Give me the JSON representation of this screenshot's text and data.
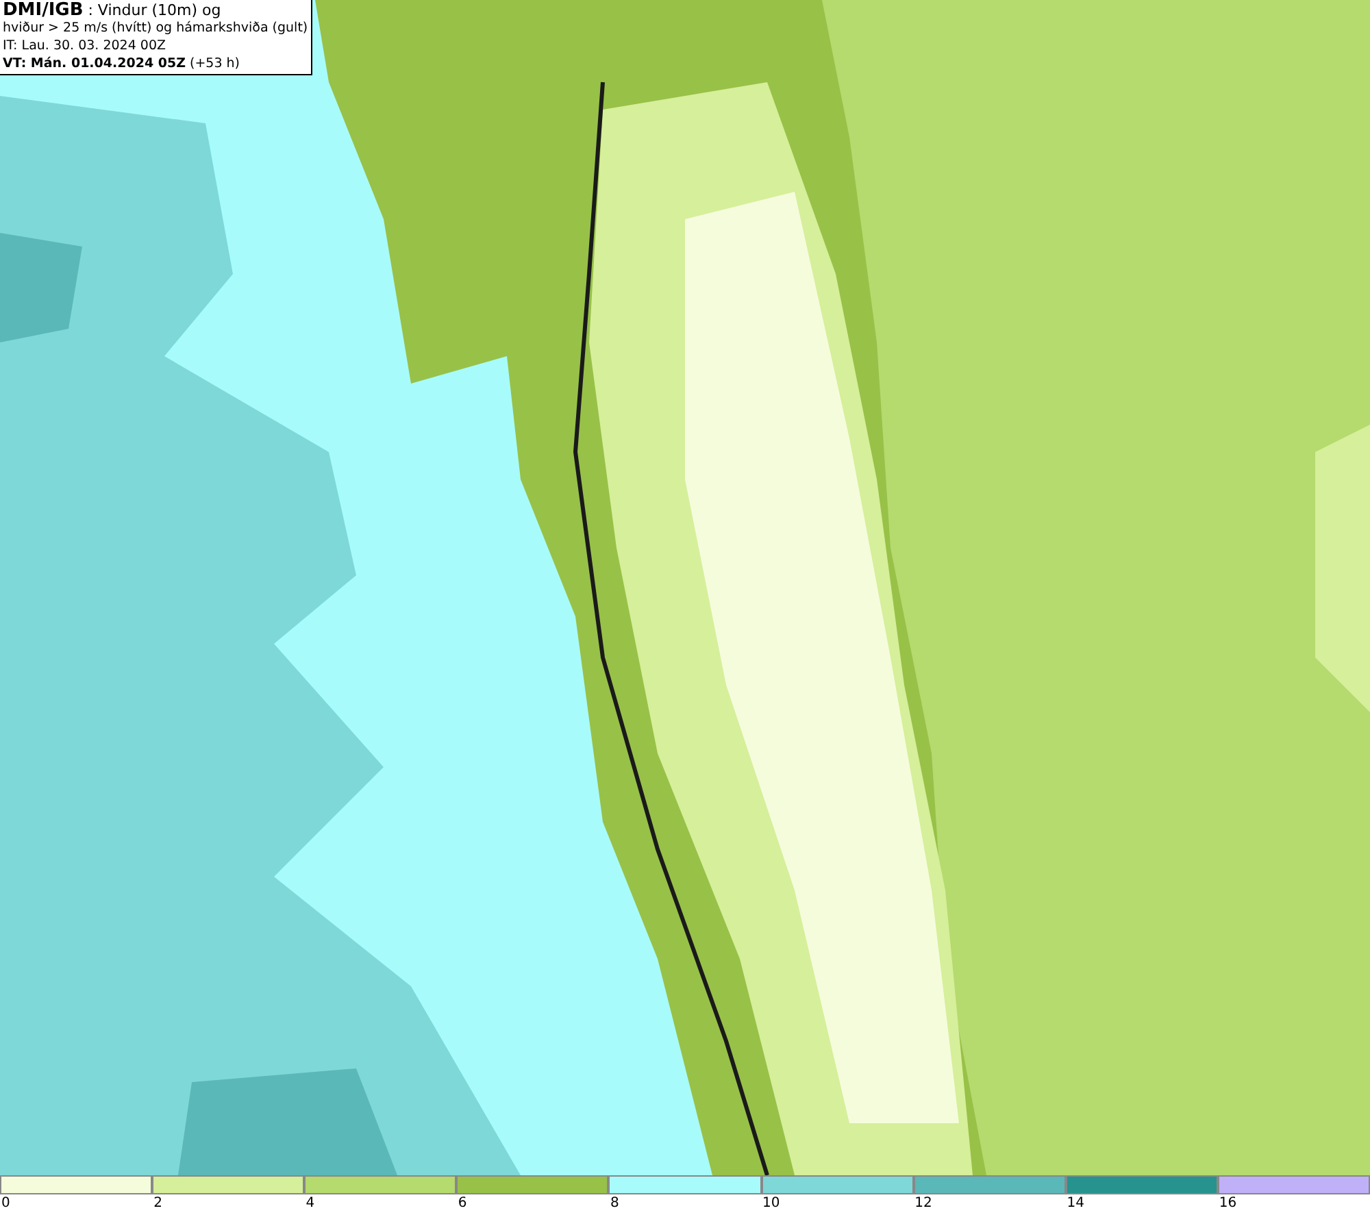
{
  "title_box": {
    "lines": [
      "**DMI/IGB** : Vindur (10m) og",
      "hviður > 25 m/s (hvítt) og hámarkshviða (gult)",
      "IT: Lau. 30. 03. 2024 00Z",
      "**VT: Mán. 01.04.2024 05Z** (+53 h)"
    ]
  },
  "legend": [
    {
      "label": "0",
      "color": "#f5fcdc"
    },
    {
      "label": "2",
      "color": "#d6ef9a"
    },
    {
      "label": "4",
      "color": "#b5da6e"
    },
    {
      "label": "6",
      "color": "#98c148"
    },
    {
      "label": "8",
      "color": "#a8fbfb"
    },
    {
      "label": "10",
      "color": "#7fd8d8"
    },
    {
      "label": "12",
      "color": "#5ab8b8"
    },
    {
      "label": "14",
      "color": "#26938f"
    },
    {
      "label": "16",
      "color": "#c0b0f8"
    }
  ]
}
